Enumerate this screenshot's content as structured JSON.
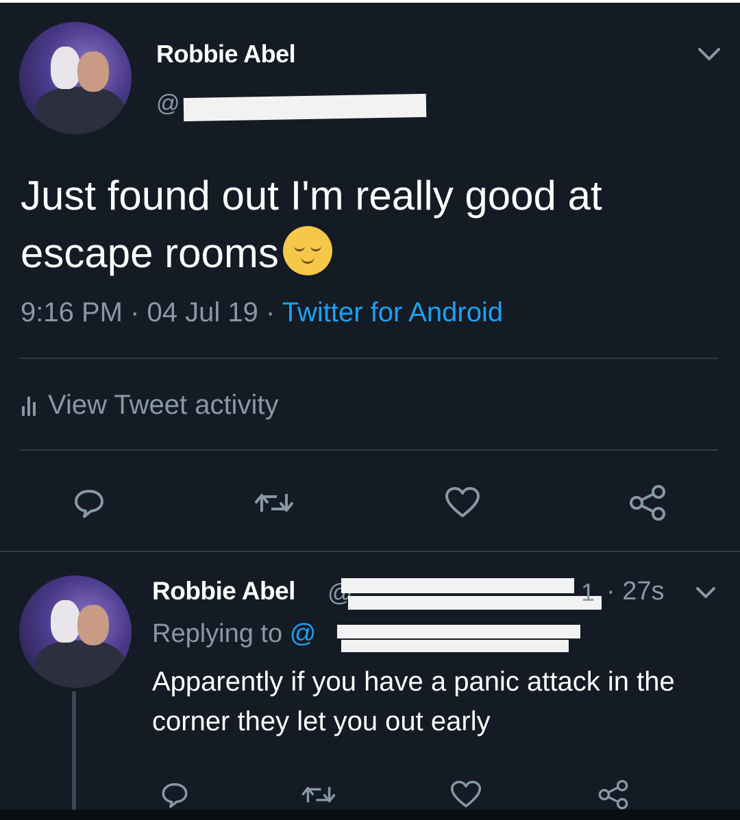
{
  "tweet": {
    "author_name": "Robbie Abel",
    "handle_prefix": "@",
    "text": "Just found out I'm really good at escape rooms",
    "emoji": "relieved-face-emoji",
    "time": "9:16 PM",
    "date": "04 Jul 19",
    "source": "Twitter for Android",
    "separator": "·",
    "activity_label": "View Tweet activity"
  },
  "reply": {
    "author_name": "Robbie Abel",
    "handle_prefix": "@",
    "handle_tail": "1",
    "time_sep": "·",
    "time": "27s",
    "replying_to_label": "Replying to",
    "replying_handle_prefix": "@",
    "text": "Apparently if you have a panic attack in the corner they let you out early"
  },
  "colors": {
    "background": "#141b24",
    "text": "#ffffff",
    "muted": "#8899a6",
    "link": "#1da1f2"
  }
}
